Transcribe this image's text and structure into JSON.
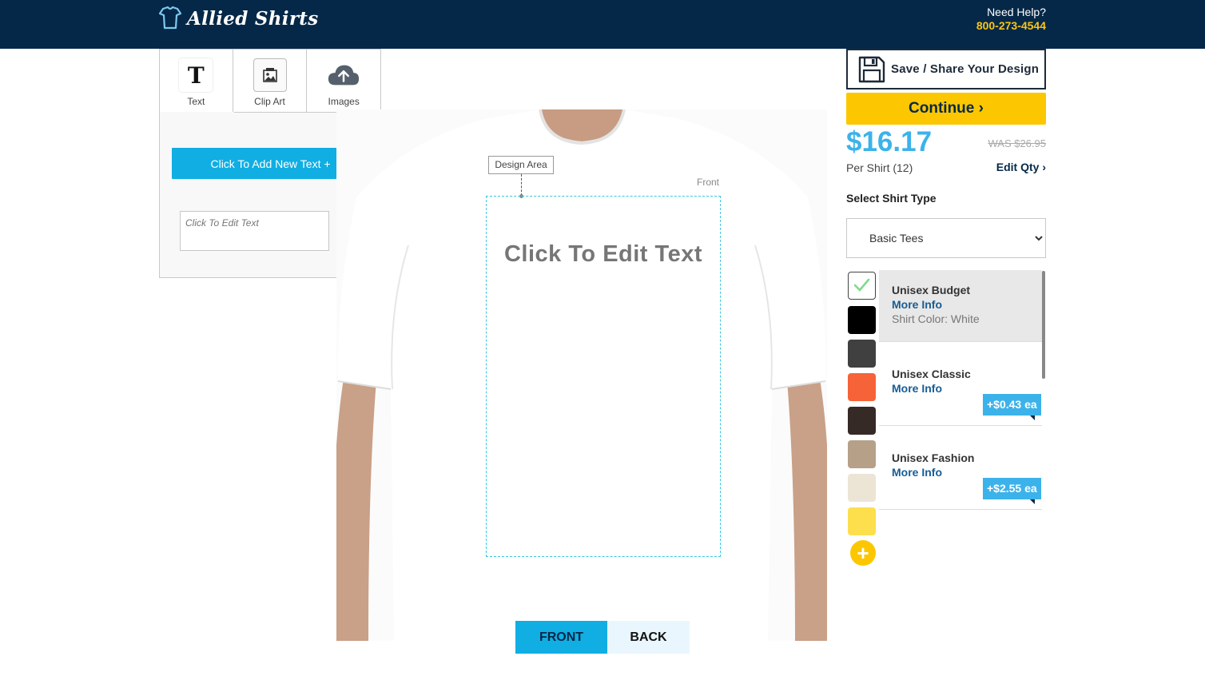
{
  "header": {
    "brand": "Allied Shirts",
    "help_label": "Need Help?",
    "phone": "800-273-4544"
  },
  "tools": {
    "tabs": [
      {
        "label": "Text",
        "icon": "text-t-icon"
      },
      {
        "label": "Clip Art",
        "icon": "clip-art-icon"
      },
      {
        "label": "Images",
        "icon": "cloud-upload-icon"
      }
    ],
    "add_text_label": "Click To Add New Text +",
    "edit_text_placeholder": "Click To Edit Text"
  },
  "canvas": {
    "design_area_label": "Design Area",
    "side_label": "Front",
    "design_text": "Click To Edit Text",
    "front_label": "FRONT",
    "back_label": "BACK"
  },
  "order": {
    "save_label": "Save / Share Your Design",
    "continue_label": "Continue",
    "price": "$16.17",
    "was_price": "WAS $26.95",
    "per_shirt": "Per Shirt (12)",
    "edit_qty": "Edit Qty",
    "select_label": "Select Shirt Type",
    "shirt_type_selected": "Basic Tees",
    "swatch_colors": [
      "#ffffff",
      "#000000",
      "#404040",
      "#f66338",
      "#352a25",
      "#b6a088",
      "#ece5d6",
      "#fddf4e"
    ],
    "types": [
      {
        "name": "Unisex Budget",
        "more": "More Info",
        "color": "Shirt Color: White",
        "price": ""
      },
      {
        "name": "Unisex Classic",
        "more": "More Info",
        "color": "",
        "price": "+$0.43 ea"
      },
      {
        "name": "Unisex Fashion",
        "more": "More Info",
        "color": "",
        "price": "+$2.55 ea"
      }
    ]
  }
}
